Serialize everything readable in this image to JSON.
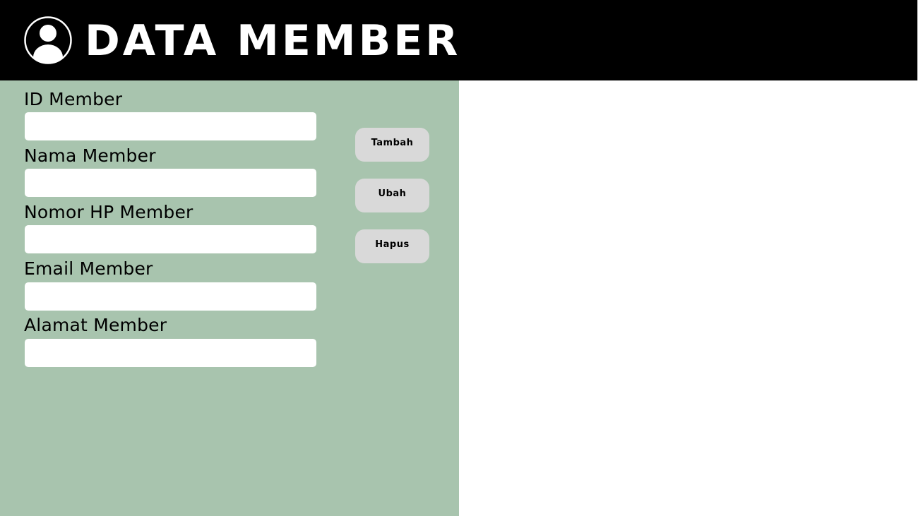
{
  "header": {
    "title": "DATA MEMBER",
    "icon": "user-avatar-icon"
  },
  "colors": {
    "header_bg": "#000000",
    "panel_bg": "#a8c4ae",
    "button_bg": "#d9d9d9",
    "input_bg": "#ffffff"
  },
  "form": {
    "fields": [
      {
        "label": "ID Member",
        "value": "",
        "placeholder": ""
      },
      {
        "label": "Nama Member",
        "value": "",
        "placeholder": ""
      },
      {
        "label": "Nomor HP Member",
        "value": "",
        "placeholder": ""
      },
      {
        "label": "Email Member",
        "value": "",
        "placeholder": ""
      },
      {
        "label": "Alamat Member",
        "value": "",
        "placeholder": ""
      }
    ]
  },
  "actions": {
    "add_label": "Tambah",
    "edit_label": "Ubah",
    "delete_label": "Hapus"
  }
}
